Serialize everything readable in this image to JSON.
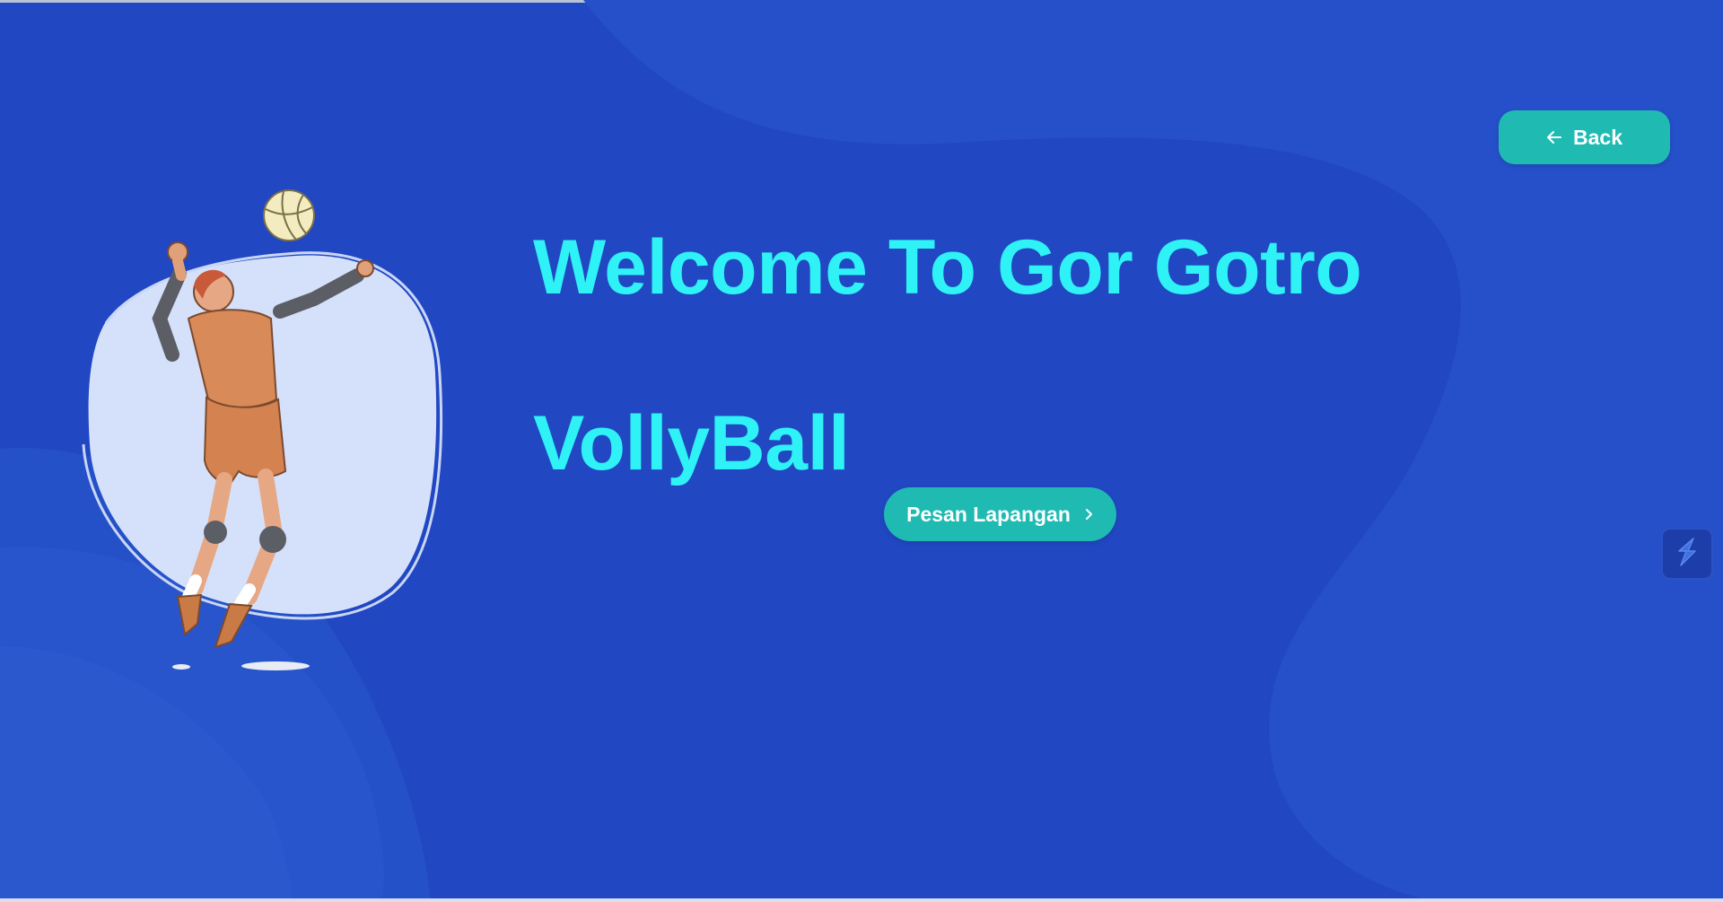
{
  "hero": {
    "title_line1": "Welcome To Gor Gotro",
    "title_line2": "VollyBall"
  },
  "buttons": {
    "back_label": "Back",
    "back_icon": "arrow-left-icon",
    "booking_label": "Pesan Lapangan",
    "booking_icon": "chevron-right-icon"
  },
  "illustration": {
    "subject": "volleyball-player-serving",
    "icon": "volleyball-icon"
  },
  "widget": {
    "icon": "lightning-icon"
  },
  "colors": {
    "background": "#2147c3",
    "title": "#2ef2f6",
    "button": "#1fbbb3",
    "button_text": "#ffffff"
  }
}
